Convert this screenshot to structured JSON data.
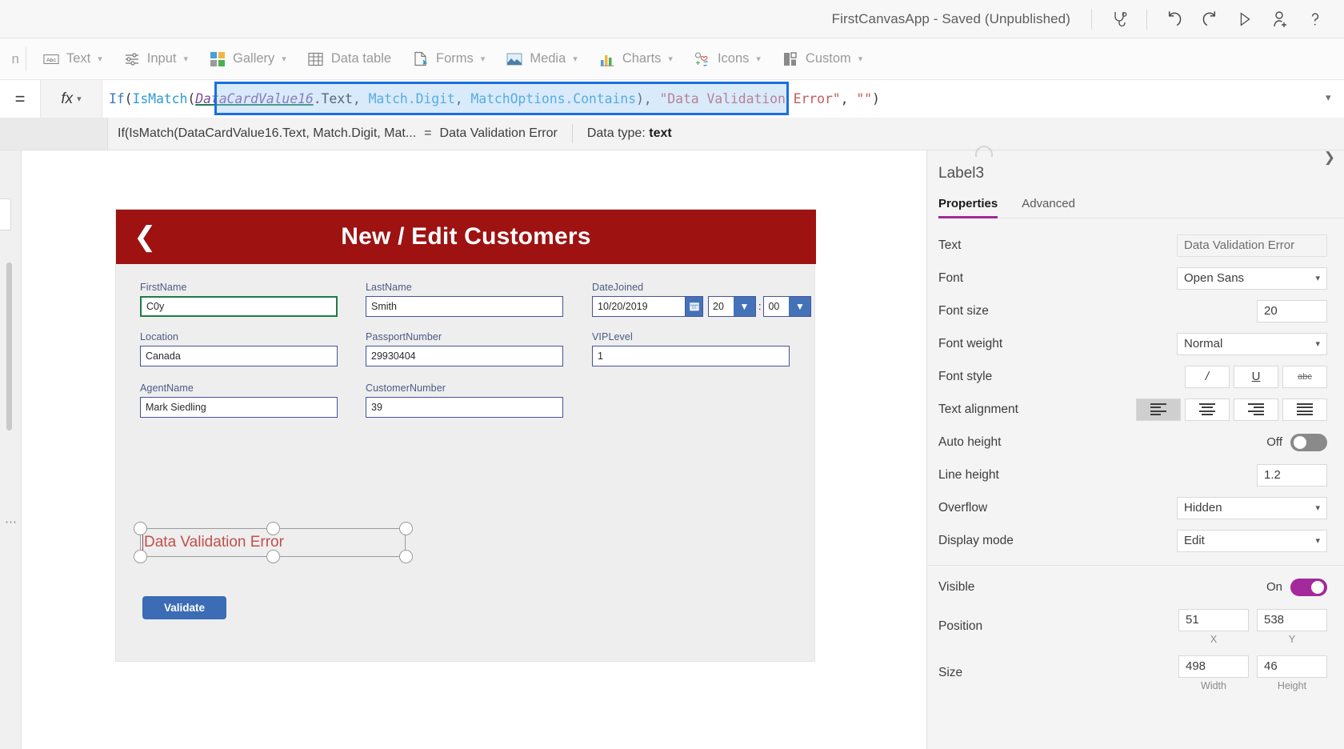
{
  "titlebar": {
    "app_title": "FirstCanvasApp - Saved (Unpublished)",
    "icons": [
      {
        "name": "app-checker-icon",
        "label": "App checker"
      },
      {
        "name": "undo-icon",
        "label": "Undo"
      },
      {
        "name": "redo-icon",
        "label": "Redo"
      },
      {
        "name": "preview-play-icon",
        "label": "Preview the app"
      },
      {
        "name": "share-user-icon",
        "label": "Share"
      },
      {
        "name": "help-question-icon",
        "label": "Help"
      }
    ]
  },
  "ribbon": {
    "ghost_left": "n",
    "items": [
      {
        "label": "Text",
        "icon": "text-abc-icon",
        "has_chevron": true
      },
      {
        "label": "Input",
        "icon": "input-sliders-icon",
        "has_chevron": true
      },
      {
        "label": "Gallery",
        "icon": "gallery-squares-icon",
        "has_chevron": true
      },
      {
        "label": "Data table",
        "icon": "data-table-icon",
        "has_chevron": false
      },
      {
        "label": "Forms",
        "icon": "forms-document-icon",
        "has_chevron": true
      },
      {
        "label": "Media",
        "icon": "media-image-icon",
        "has_chevron": true
      },
      {
        "label": "Charts",
        "icon": "charts-bar-icon",
        "has_chevron": true
      },
      {
        "label": "Icons",
        "icon": "icons-shapes-icon",
        "has_chevron": true
      },
      {
        "label": "Custom",
        "icon": "custom-blocks-icon",
        "has_chevron": true
      }
    ]
  },
  "formula_bar": {
    "equals": "=",
    "fx_label": "fx",
    "tokens": [
      {
        "text": "If",
        "type": "fn"
      },
      {
        "text": "(",
        "type": "punct"
      },
      {
        "text": "IsMatch",
        "type": "fn2"
      },
      {
        "text": "(",
        "type": "punct"
      },
      {
        "text": "DataCardValue16",
        "type": "var"
      },
      {
        "text": ".Text",
        "type": "prop"
      },
      {
        "text": ", ",
        "type": "punct"
      },
      {
        "text": "Match.Digit",
        "type": "enum"
      },
      {
        "text": ", ",
        "type": "punct"
      },
      {
        "text": "MatchOptions.Contains",
        "type": "enum"
      },
      {
        "text": ")",
        "type": "punct"
      },
      {
        "text": ", ",
        "type": "punct"
      },
      {
        "text": "\"Data Validation Error\"",
        "type": "str"
      },
      {
        "text": ", ",
        "type": "punct"
      },
      {
        "text": "\"\"",
        "type": "str"
      },
      {
        "text": ")",
        "type": "punct"
      }
    ],
    "full_text": "If(IsMatch(DataCardValue16.Text, Match.Digit, MatchOptions.Contains), \"Data Validation Error\", \"\")",
    "expand_chevron": "chevron-down-icon"
  },
  "formula_status": {
    "expression": "If(IsMatch(DataCardValue16.Text, Match.Digit, Mat...",
    "equals": "=",
    "result_value": "Data Validation Error",
    "data_type_label": "Data type:",
    "data_type_value": "text"
  },
  "canvas": {
    "screen_header": {
      "back_icon": "chevron-left-icon",
      "title": "New / Edit Customers",
      "bg_color": "#9e1212"
    },
    "fields": [
      {
        "label": "FirstName",
        "value": "C0y",
        "focused": true
      },
      {
        "label": "LastName",
        "value": "Smith",
        "focused": false
      },
      {
        "label": "Location",
        "value": "Canada",
        "focused": false
      },
      {
        "label": "PassportNumber",
        "value": "29930404",
        "focused": false
      },
      {
        "label": "AgentName",
        "value": "Mark Siedling",
        "focused": false
      },
      {
        "label": "CustomerNumber",
        "value": "39",
        "focused": false
      },
      {
        "label": "VIPLevel",
        "value": "1",
        "focused": false
      }
    ],
    "date_field": {
      "label": "DateJoined",
      "date_value": "10/20/2019",
      "calendar_icon": "calendar-icon",
      "hour_value": "20",
      "minute_value": "00",
      "separator": ":"
    },
    "selected_label": {
      "text": "Data Validation Error",
      "color": "#c0504d"
    },
    "validate_button": {
      "label": "Validate",
      "color": "#3b6cb5"
    }
  },
  "properties_panel": {
    "control_name": "Label3",
    "tabs": [
      {
        "label": "Properties",
        "active": true
      },
      {
        "label": "Advanced",
        "active": false
      }
    ],
    "accent_color": "#a4299a",
    "rows": {
      "text": {
        "label": "Text",
        "value": "Data Validation Error"
      },
      "font": {
        "label": "Font",
        "value": "Open Sans"
      },
      "font_size": {
        "label": "Font size",
        "value": "20"
      },
      "font_weight": {
        "label": "Font weight",
        "value": "Normal"
      },
      "font_style": {
        "label": "Font style",
        "buttons": [
          {
            "name": "italic-button",
            "glyph": "/"
          },
          {
            "name": "underline-button",
            "glyph": "U"
          },
          {
            "name": "strikethrough-button",
            "glyph": "abc"
          }
        ]
      },
      "text_alignment": {
        "label": "Text alignment",
        "buttons": [
          {
            "name": "align-left-button",
            "active": true
          },
          {
            "name": "align-center-button",
            "active": false
          },
          {
            "name": "align-right-button",
            "active": false
          },
          {
            "name": "align-justify-button",
            "active": false
          }
        ]
      },
      "auto_height": {
        "label": "Auto height",
        "state_label": "Off",
        "on": false
      },
      "line_height": {
        "label": "Line height",
        "value": "1.2"
      },
      "overflow": {
        "label": "Overflow",
        "value": "Hidden"
      },
      "display_mode": {
        "label": "Display mode",
        "value": "Edit"
      },
      "visible": {
        "label": "Visible",
        "state_label": "On",
        "on": true
      },
      "position": {
        "label": "Position",
        "x": "51",
        "y": "538",
        "x_cap": "X",
        "y_cap": "Y"
      },
      "size": {
        "label": "Size",
        "width": "498",
        "height": "46",
        "w_cap": "Width",
        "h_cap": "Height"
      }
    }
  }
}
